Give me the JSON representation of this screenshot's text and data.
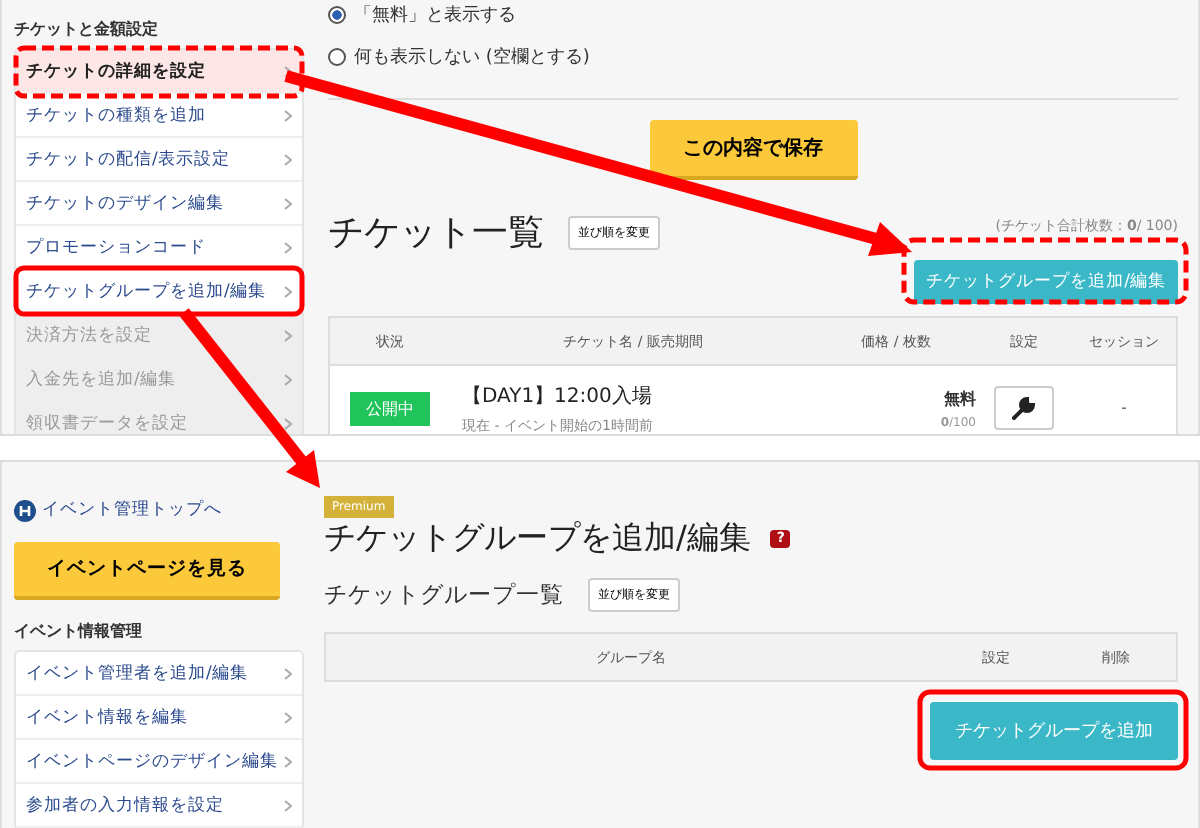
{
  "top_panel": {
    "sidebar": {
      "section": "チケットと金額設定",
      "items": [
        {
          "label": "チケットの詳細を設定",
          "selected": true,
          "disabled": false
        },
        {
          "label": "チケットの種類を追加",
          "selected": false,
          "disabled": false
        },
        {
          "label": "チケットの配信/表示設定",
          "selected": false,
          "disabled": false
        },
        {
          "label": "チケットのデザイン編集",
          "selected": false,
          "disabled": false
        },
        {
          "label": "プロモーションコード",
          "selected": false,
          "disabled": false
        },
        {
          "label": "チケットグループを追加/編集",
          "selected": false,
          "disabled": false
        },
        {
          "label": "決済方法を設定",
          "selected": false,
          "disabled": true
        },
        {
          "label": "入金先を追加/編集",
          "selected": false,
          "disabled": true
        },
        {
          "label": "領収書データを設定",
          "selected": false,
          "disabled": true
        }
      ]
    },
    "radios": [
      {
        "label": "「無料」と表示する",
        "selected": true
      },
      {
        "label": "何も表示しない (空欄とする)",
        "selected": false
      }
    ],
    "save_button": "この内容で保存",
    "title": "チケット一覧",
    "sort_button": "並び順を変更",
    "total": "(チケット合計枚数：**0**/ 100)",
    "group_button": "チケットグループを追加/編集",
    "table": {
      "columns": [
        "状況",
        "チケット名 / 販売期間",
        "価格 / 枚数",
        "設定",
        "セッション"
      ],
      "rows": [
        {
          "status": "公開中",
          "name": "【DAY1】12:00入場",
          "period": "現在 - イベント開始の1時間前",
          "price": "無料",
          "count": "**0**/100",
          "session": "-"
        }
      ]
    }
  },
  "bottom_panel": {
    "top_link": "イベント管理トップへ",
    "view_button": "イベントページを見る",
    "sidebar": {
      "section": "イベント情報管理",
      "items": [
        {
          "label": "イベント管理者を追加/編集",
          "selected": false
        },
        {
          "label": "イベント情報を編集",
          "selected": false
        },
        {
          "label": "イベントページのデザイン編集",
          "selected": false
        },
        {
          "label": "参加者の入力情報を設定",
          "selected": false
        }
      ]
    },
    "badge": "Premium",
    "title": "チケットグループを追加/編集",
    "help": "?",
    "subtitle": "チケットグループ一覧",
    "sort_button": "並び順を変更",
    "table": {
      "columns": [
        "グループ名",
        "設定",
        "削除"
      ]
    },
    "add_button": "チケットグループを追加"
  }
}
